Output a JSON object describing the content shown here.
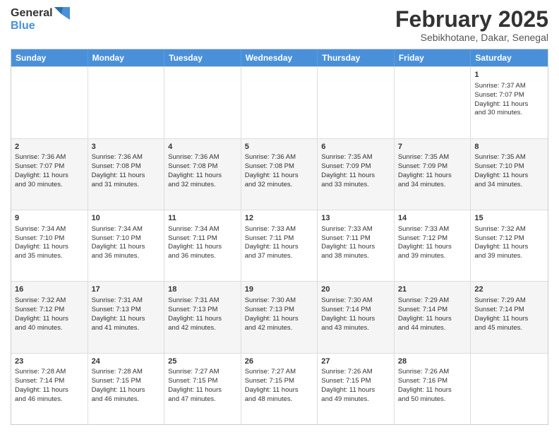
{
  "logo": {
    "line1": "General",
    "line2": "Blue"
  },
  "title": "February 2025",
  "subtitle": "Sebikhotane, Dakar, Senegal",
  "days": [
    "Sunday",
    "Monday",
    "Tuesday",
    "Wednesday",
    "Thursday",
    "Friday",
    "Saturday"
  ],
  "weeks": [
    {
      "alt": false,
      "cells": [
        {
          "day": "",
          "info": ""
        },
        {
          "day": "",
          "info": ""
        },
        {
          "day": "",
          "info": ""
        },
        {
          "day": "",
          "info": ""
        },
        {
          "day": "",
          "info": ""
        },
        {
          "day": "",
          "info": ""
        },
        {
          "day": "1",
          "info": "Sunrise: 7:37 AM\nSunset: 7:07 PM\nDaylight: 11 hours\nand 30 minutes."
        }
      ]
    },
    {
      "alt": true,
      "cells": [
        {
          "day": "2",
          "info": "Sunrise: 7:36 AM\nSunset: 7:07 PM\nDaylight: 11 hours\nand 30 minutes."
        },
        {
          "day": "3",
          "info": "Sunrise: 7:36 AM\nSunset: 7:08 PM\nDaylight: 11 hours\nand 31 minutes."
        },
        {
          "day": "4",
          "info": "Sunrise: 7:36 AM\nSunset: 7:08 PM\nDaylight: 11 hours\nand 32 minutes."
        },
        {
          "day": "5",
          "info": "Sunrise: 7:36 AM\nSunset: 7:08 PM\nDaylight: 11 hours\nand 32 minutes."
        },
        {
          "day": "6",
          "info": "Sunrise: 7:35 AM\nSunset: 7:09 PM\nDaylight: 11 hours\nand 33 minutes."
        },
        {
          "day": "7",
          "info": "Sunrise: 7:35 AM\nSunset: 7:09 PM\nDaylight: 11 hours\nand 34 minutes."
        },
        {
          "day": "8",
          "info": "Sunrise: 7:35 AM\nSunset: 7:10 PM\nDaylight: 11 hours\nand 34 minutes."
        }
      ]
    },
    {
      "alt": false,
      "cells": [
        {
          "day": "9",
          "info": "Sunrise: 7:34 AM\nSunset: 7:10 PM\nDaylight: 11 hours\nand 35 minutes."
        },
        {
          "day": "10",
          "info": "Sunrise: 7:34 AM\nSunset: 7:10 PM\nDaylight: 11 hours\nand 36 minutes."
        },
        {
          "day": "11",
          "info": "Sunrise: 7:34 AM\nSunset: 7:11 PM\nDaylight: 11 hours\nand 36 minutes."
        },
        {
          "day": "12",
          "info": "Sunrise: 7:33 AM\nSunset: 7:11 PM\nDaylight: 11 hours\nand 37 minutes."
        },
        {
          "day": "13",
          "info": "Sunrise: 7:33 AM\nSunset: 7:11 PM\nDaylight: 11 hours\nand 38 minutes."
        },
        {
          "day": "14",
          "info": "Sunrise: 7:33 AM\nSunset: 7:12 PM\nDaylight: 11 hours\nand 39 minutes."
        },
        {
          "day": "15",
          "info": "Sunrise: 7:32 AM\nSunset: 7:12 PM\nDaylight: 11 hours\nand 39 minutes."
        }
      ]
    },
    {
      "alt": true,
      "cells": [
        {
          "day": "16",
          "info": "Sunrise: 7:32 AM\nSunset: 7:12 PM\nDaylight: 11 hours\nand 40 minutes."
        },
        {
          "day": "17",
          "info": "Sunrise: 7:31 AM\nSunset: 7:13 PM\nDaylight: 11 hours\nand 41 minutes."
        },
        {
          "day": "18",
          "info": "Sunrise: 7:31 AM\nSunset: 7:13 PM\nDaylight: 11 hours\nand 42 minutes."
        },
        {
          "day": "19",
          "info": "Sunrise: 7:30 AM\nSunset: 7:13 PM\nDaylight: 11 hours\nand 42 minutes."
        },
        {
          "day": "20",
          "info": "Sunrise: 7:30 AM\nSunset: 7:14 PM\nDaylight: 11 hours\nand 43 minutes."
        },
        {
          "day": "21",
          "info": "Sunrise: 7:29 AM\nSunset: 7:14 PM\nDaylight: 11 hours\nand 44 minutes."
        },
        {
          "day": "22",
          "info": "Sunrise: 7:29 AM\nSunset: 7:14 PM\nDaylight: 11 hours\nand 45 minutes."
        }
      ]
    },
    {
      "alt": false,
      "cells": [
        {
          "day": "23",
          "info": "Sunrise: 7:28 AM\nSunset: 7:14 PM\nDaylight: 11 hours\nand 46 minutes."
        },
        {
          "day": "24",
          "info": "Sunrise: 7:28 AM\nSunset: 7:15 PM\nDaylight: 11 hours\nand 46 minutes."
        },
        {
          "day": "25",
          "info": "Sunrise: 7:27 AM\nSunset: 7:15 PM\nDaylight: 11 hours\nand 47 minutes."
        },
        {
          "day": "26",
          "info": "Sunrise: 7:27 AM\nSunset: 7:15 PM\nDaylight: 11 hours\nand 48 minutes."
        },
        {
          "day": "27",
          "info": "Sunrise: 7:26 AM\nSunset: 7:15 PM\nDaylight: 11 hours\nand 49 minutes."
        },
        {
          "day": "28",
          "info": "Sunrise: 7:26 AM\nSunset: 7:16 PM\nDaylight: 11 hours\nand 50 minutes."
        },
        {
          "day": "",
          "info": ""
        }
      ]
    }
  ]
}
